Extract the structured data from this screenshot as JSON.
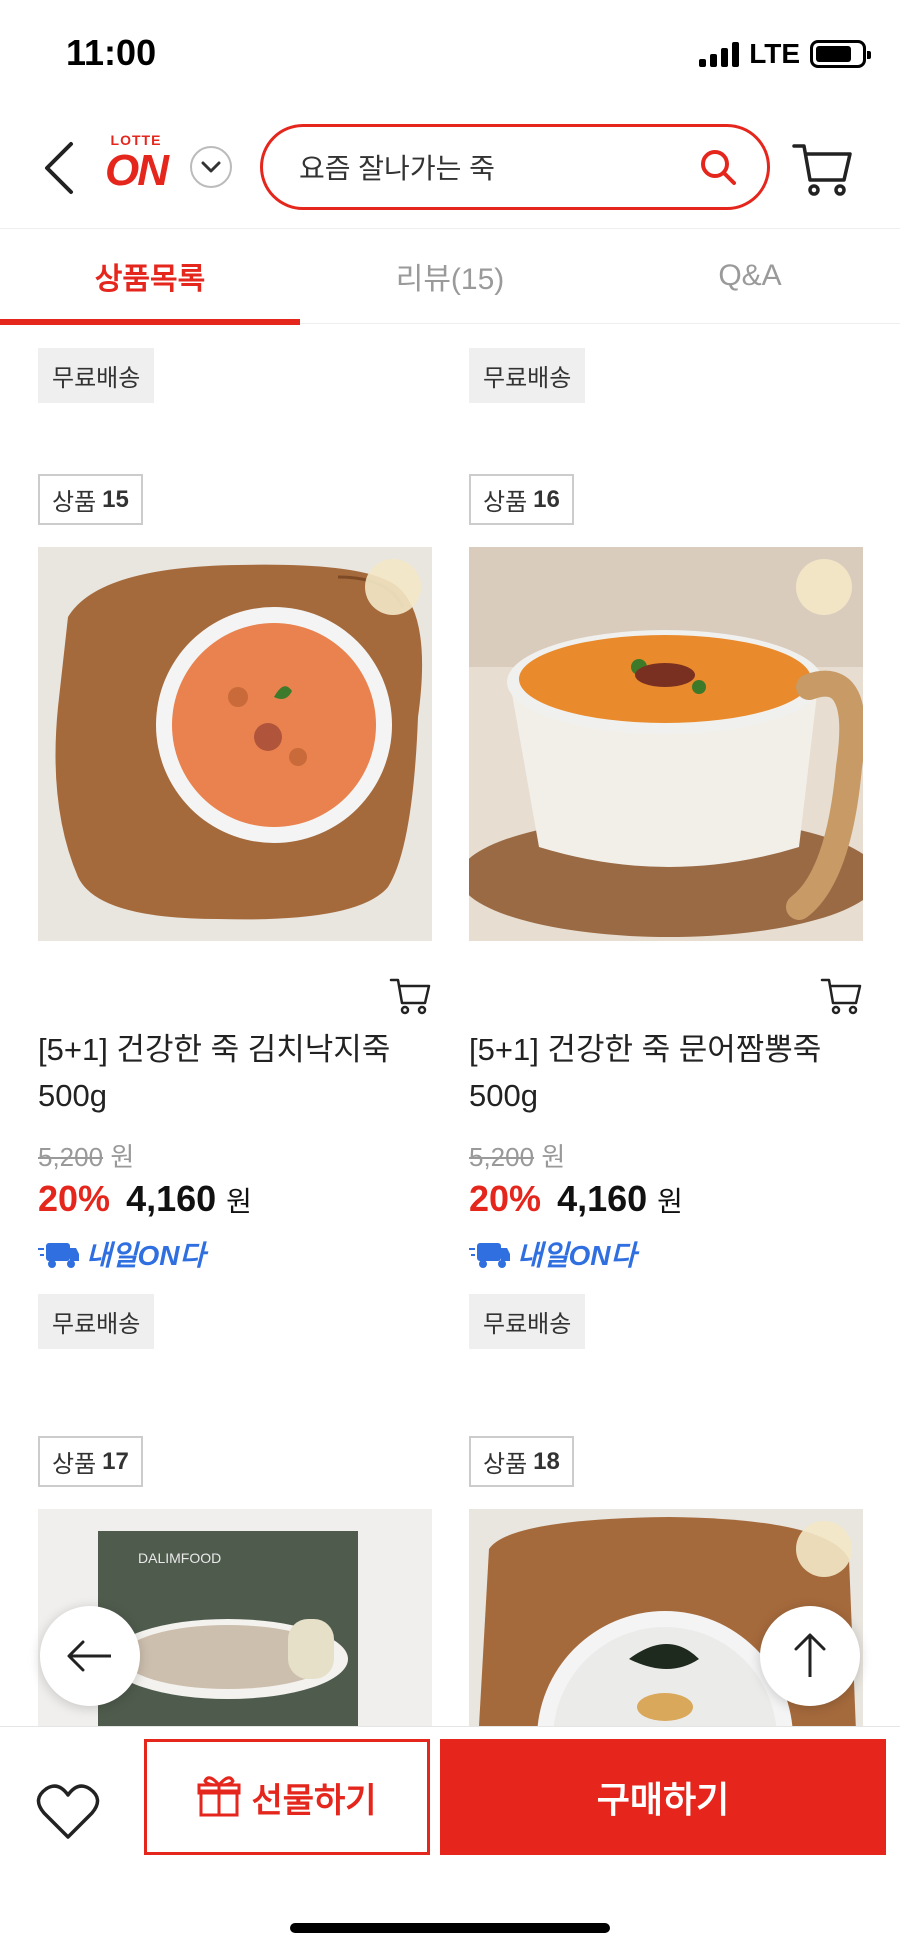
{
  "status_bar": {
    "time": "11:00",
    "network": "LTE"
  },
  "header": {
    "logo_top": "LOTTE",
    "logo_main": "ON",
    "search_value": "요즘 잘나가는 죽"
  },
  "tabs": [
    {
      "label": "상품목록",
      "active": true
    },
    {
      "label": "리뷰(15)",
      "active": false
    },
    {
      "label": "Q&A",
      "active": false
    }
  ],
  "products_top_row": [
    {
      "badge": "무료배송"
    },
    {
      "badge": "무료배송"
    }
  ],
  "products": [
    {
      "no_label": "상품",
      "no": "15",
      "title": "[5+1] 건강한 죽 김치낙지죽 500g",
      "original_price": "5,200",
      "won": "원",
      "discount": "20%",
      "price": "4,160",
      "delivery": "내일ON다",
      "badge": "무료배송"
    },
    {
      "no_label": "상품",
      "no": "16",
      "title": "[5+1] 건강한 죽 문어짬뽕죽 500g",
      "original_price": "5,200",
      "won": "원",
      "discount": "20%",
      "price": "4,160",
      "delivery": "내일ON다",
      "badge": "무료배송"
    },
    {
      "no_label": "상품",
      "no": "17",
      "package_brand": "DALIMFOOD"
    },
    {
      "no_label": "상품",
      "no": "18"
    }
  ],
  "bottom_bar": {
    "gift_label": "선물하기",
    "buy_label": "구매하기"
  },
  "colors": {
    "accent": "#e4261c",
    "delivery_blue": "#2f6fe0",
    "badge_bg": "#efefef"
  }
}
